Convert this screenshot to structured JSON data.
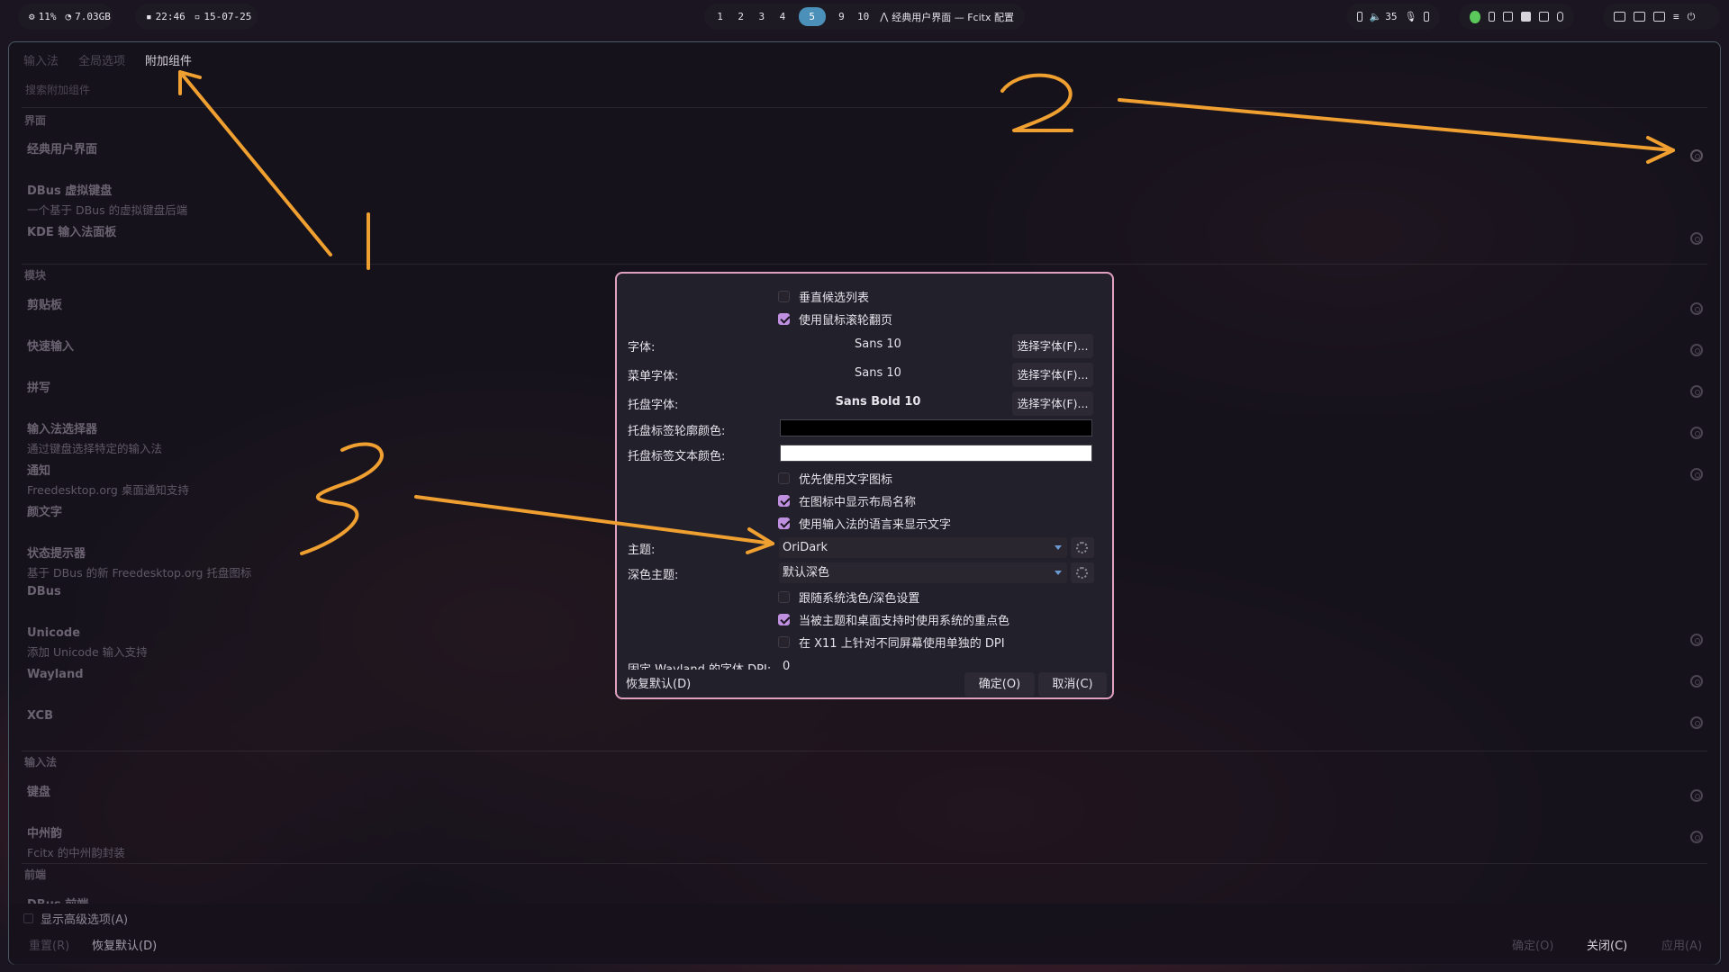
{
  "topbar": {
    "cpu": "11%",
    "mem": "7.03GB",
    "time": "22:46",
    "date": "15-07-25",
    "workspaces": [
      "1",
      "2",
      "3",
      "4",
      "5",
      "9",
      "10"
    ],
    "active_workspace": "5",
    "window_title": "经典用户界面 — Fcitx 配置",
    "volume": "35"
  },
  "main": {
    "tabs": [
      "输入法",
      "全局选项",
      "附加组件"
    ],
    "active_tab": "附加组件",
    "search_placeholder": "搜索附加组件",
    "categories": {
      "ui": "界面",
      "module": "模块",
      "im": "输入法",
      "frontend": "前端"
    },
    "entries": [
      {
        "title": "经典用户界面",
        "desc": ""
      },
      {
        "title": "DBus 虚拟键盘",
        "desc": "一个基于 DBus 的虚拟键盘后端"
      },
      {
        "title": "KDE 输入法面板",
        "desc": ""
      },
      {
        "title": "剪贴板",
        "desc": ""
      },
      {
        "title": "快速输入",
        "desc": ""
      },
      {
        "title": "拼写",
        "desc": ""
      },
      {
        "title": "输入法选择器",
        "desc": "通过键盘选择特定的输入法"
      },
      {
        "title": "通知",
        "desc": "Freedesktop.org 桌面通知支持"
      },
      {
        "title": "颜文字",
        "desc": ""
      },
      {
        "title": "状态提示器",
        "desc": "基于 DBus 的新 Freedesktop.org 托盘图标"
      },
      {
        "title": "DBus",
        "desc": ""
      },
      {
        "title": "Unicode",
        "desc": "添加 Unicode 输入支持"
      },
      {
        "title": "Wayland",
        "desc": ""
      },
      {
        "title": "XCB",
        "desc": ""
      },
      {
        "title": "键盘",
        "desc": ""
      },
      {
        "title": "中州韵",
        "desc": "Fcitx 的中州韵封装"
      },
      {
        "title": "DBus 前端",
        "desc": ""
      }
    ],
    "show_advanced": "显示高级选项(A)",
    "reset": "重置(R)",
    "restore_defaults": "恢复默认(D)",
    "ok": "确定(O)",
    "close": "关闭(C)",
    "apply": "应用(A)"
  },
  "dialog": {
    "vertical_list": "垂直候选列表",
    "wheel_page": "使用鼠标滚轮翻页",
    "font_label": "字体:",
    "font_value": "Sans 10",
    "menu_font_label": "菜单字体:",
    "menu_font_value": "Sans 10",
    "tray_font_label": "托盘字体:",
    "tray_font_value": "Sans Bold 10",
    "choose_font": "选择字体(F)...",
    "tray_outline_label": "托盘标签轮廓颜色:",
    "tray_outline_color": "#000000",
    "tray_text_label": "托盘标签文本颜色:",
    "tray_text_color": "#ffffff",
    "prefer_text_icon": "优先使用文字图标",
    "show_layout_name": "在图标中显示布局名称",
    "use_im_lang": "使用输入法的语言来显示文字",
    "theme_label": "主题:",
    "theme_value": "OriDark",
    "dark_theme_label": "深色主题:",
    "dark_theme_value": "默认深色",
    "follow_system": "跟随系统浅色/深色设置",
    "accent_color": "当被主题和桌面支持时使用系统的重点色",
    "per_screen_dpi": "在 X11 上针对不同屏幕使用单独的 DPI",
    "wayland_dpi_label": "固定 Wayland 的字体 DPI:",
    "wayland_dpi_value": "0",
    "restore_default": "恢复默认(D)",
    "ok": "确定(O)",
    "cancel": "取消(C)"
  },
  "annotations": [
    "1",
    "2",
    "3"
  ],
  "colors": {
    "accent_check": "#c090e0",
    "dialog_border": "#e0a0c0",
    "annotation": "#f0a030"
  }
}
